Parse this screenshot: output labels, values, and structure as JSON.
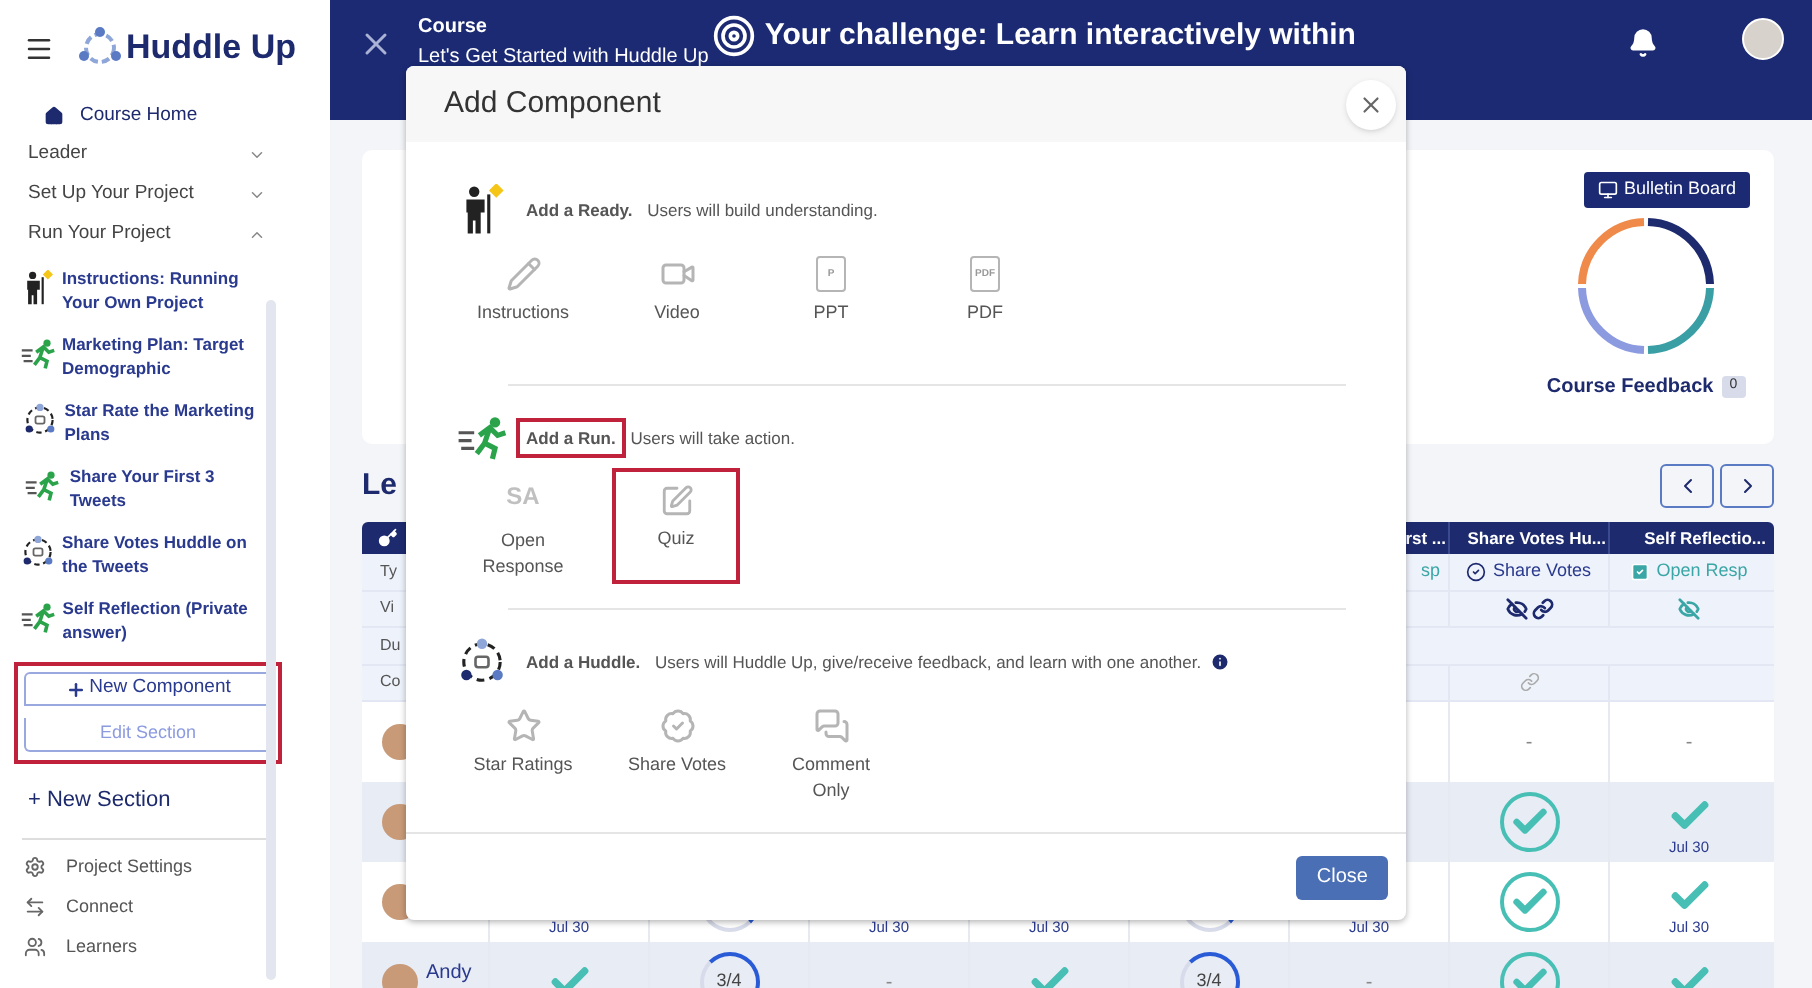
{
  "sidebar": {
    "brand": "Huddle Up",
    "course_home": "Course Home",
    "sections": [
      {
        "title": "Leader",
        "expanded": false
      },
      {
        "title": "Set Up Your Project",
        "expanded": false
      },
      {
        "title": "Run Your Project",
        "expanded": true,
        "children": [
          {
            "title": "Instructions: Running Your Own Project",
            "kind": "ready"
          },
          {
            "title": "Marketing Plan: Target Demographic",
            "kind": "run"
          },
          {
            "title": "Star Rate the Marketing Plans",
            "kind": "huddle"
          },
          {
            "title": "Share Your First 3 Tweets",
            "kind": "run"
          },
          {
            "title": "Share Votes Huddle on the Tweets",
            "kind": "huddle"
          },
          {
            "title": "Self Reflection (Private answer)",
            "kind": "run"
          }
        ]
      }
    ],
    "section_actions": {
      "highlighted": true,
      "new_component": "New Component",
      "edit_section": "Edit Section"
    },
    "new_section": "+ New Section",
    "links": [
      {
        "label": "Project Settings",
        "kind": "settings"
      },
      {
        "label": "Connect",
        "kind": "connect"
      },
      {
        "label": "Learners",
        "kind": "learners"
      }
    ]
  },
  "header": {
    "label": "Course",
    "course_title": "Let's Get Started with Huddle Up",
    "challenge": "Your challenge: Learn interactively within"
  },
  "overview": {
    "bulletin_board": "Bulletin Board",
    "feedback_label": "Course Feedback",
    "feedback_count": "0"
  },
  "leaderboard": {
    "title": "Le",
    "headers": [
      "rst ...",
      "Share Votes Hu...",
      "Self Reflectio..."
    ],
    "info_rows": [
      {
        "label": "Ty",
        "cells": [
          {
            "kind": "teal_text",
            "text": "sp"
          },
          {
            "kind": "vote_type",
            "text": "Share Votes"
          },
          {
            "kind": "response_type",
            "text": "Open Resp"
          }
        ]
      },
      {
        "label": "Vi",
        "cells": [
          {
            "kind": "empty"
          },
          {
            "kind": "hidden_link"
          },
          {
            "kind": "hidden"
          }
        ]
      },
      {
        "label": "Du",
        "cells": []
      },
      {
        "label": "Co",
        "cells": [
          {
            "kind": "empty"
          },
          {
            "kind": "link"
          },
          {
            "kind": "empty"
          }
        ]
      }
    ],
    "student_rows": [
      {
        "cells": [
          {
            "kind": "dash",
            "text": "-"
          },
          {
            "kind": "dash",
            "text": "-"
          }
        ]
      },
      {
        "cells": [
          {
            "kind": "check_circle"
          },
          {
            "kind": "check",
            "date": "Jul 30"
          }
        ]
      },
      {
        "cells": [
          {
            "kind": "date",
            "date": "Jul 30"
          },
          {
            "kind": "ring"
          },
          {
            "kind": "date",
            "date": "Jul 30"
          },
          {
            "kind": "date",
            "date": "Jul 30"
          },
          {
            "kind": "ring"
          },
          {
            "kind": "date",
            "date": "Jul 30"
          },
          {
            "kind": "check_circle"
          },
          {
            "kind": "check",
            "date": "Jul 30"
          }
        ]
      },
      {
        "name": "Andy",
        "cells": [
          {
            "kind": "check"
          },
          {
            "kind": "ring",
            "text": "3/4"
          },
          {
            "kind": "dash",
            "text": "-"
          },
          {
            "kind": "check"
          },
          {
            "kind": "ring",
            "text": "3/4"
          },
          {
            "kind": "dash",
            "text": "-"
          },
          {
            "kind": "check_circle"
          },
          {
            "kind": "check"
          }
        ]
      }
    ]
  },
  "modal": {
    "title": "Add Component",
    "close": "Close",
    "sections": [
      {
        "kind": "ready",
        "lead": "Add a Ready.",
        "text": "Users will build understanding.",
        "highlighted": false,
        "info": false,
        "options": [
          {
            "label": "Instructions",
            "kind": "pencil",
            "highlighted": false
          },
          {
            "label": "Video",
            "kind": "video",
            "highlighted": false
          },
          {
            "label": "PPT",
            "kind": "doc",
            "glyph": "P",
            "highlighted": false
          },
          {
            "label": "PDF",
            "kind": "doc",
            "glyph": "PDF",
            "highlighted": false
          }
        ]
      },
      {
        "kind": "run",
        "lead": "Add a Run.",
        "text": "Users will take action.",
        "highlighted": true,
        "info": false,
        "options": [
          {
            "label": "Open Response",
            "kind": "letters",
            "glyph": "SA",
            "highlighted": false
          },
          {
            "label": "Quiz",
            "kind": "quiz",
            "highlighted": true
          }
        ]
      },
      {
        "kind": "huddle",
        "lead": "Add a Huddle.",
        "text": "Users will Huddle Up, give/receive feedback, and learn with one another.",
        "highlighted": false,
        "info": true,
        "options": [
          {
            "label": "Star Ratings",
            "kind": "star",
            "highlighted": false
          },
          {
            "label": "Share Votes",
            "kind": "vote",
            "highlighted": false
          },
          {
            "label": "Comment Only",
            "kind": "comment",
            "highlighted": false
          }
        ]
      }
    ]
  }
}
